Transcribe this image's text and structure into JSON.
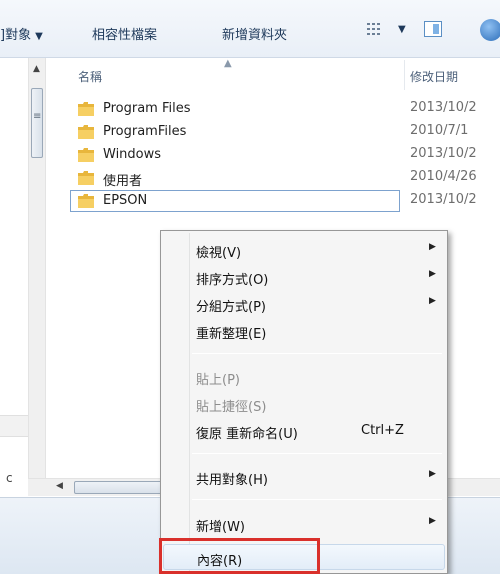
{
  "toolbar": {
    "share_label": "]對象",
    "burn_label": "相容性檔案",
    "new_folder_label": "新增資料夾"
  },
  "columns": {
    "name": "名稱",
    "date": "修改日期"
  },
  "files": [
    {
      "name": "Program Files",
      "date": "2013/10/2",
      "selected": false
    },
    {
      "name": "ProgramFiles",
      "date": "2010/7/1",
      "selected": false
    },
    {
      "name": "Windows",
      "date": "2013/10/2",
      "selected": false
    },
    {
      "name": "使用者",
      "date": "2010/4/26",
      "selected": false
    },
    {
      "name": "EPSON",
      "date": "2013/10/2",
      "selected": true
    }
  ],
  "nav": {
    "partial_label": "c"
  },
  "context_menu": {
    "view": "檢視(V)",
    "sort_by": "排序方式(O)",
    "group_by": "分組方式(P)",
    "refresh": "重新整理(E)",
    "paste": "貼上(P)",
    "paste_shortcut": "貼上捷徑(S)",
    "undo_rename": "復原 重新命名(U)",
    "undo_rename_shortcut": "Ctrl+Z",
    "share_with": "共用對象(H)",
    "new": "新增(W)",
    "properties": "內容(R)"
  },
  "colors": {
    "folder": "#e8b63c",
    "highlight_box": "#d9302b",
    "selection_border": "#7da2ce"
  }
}
